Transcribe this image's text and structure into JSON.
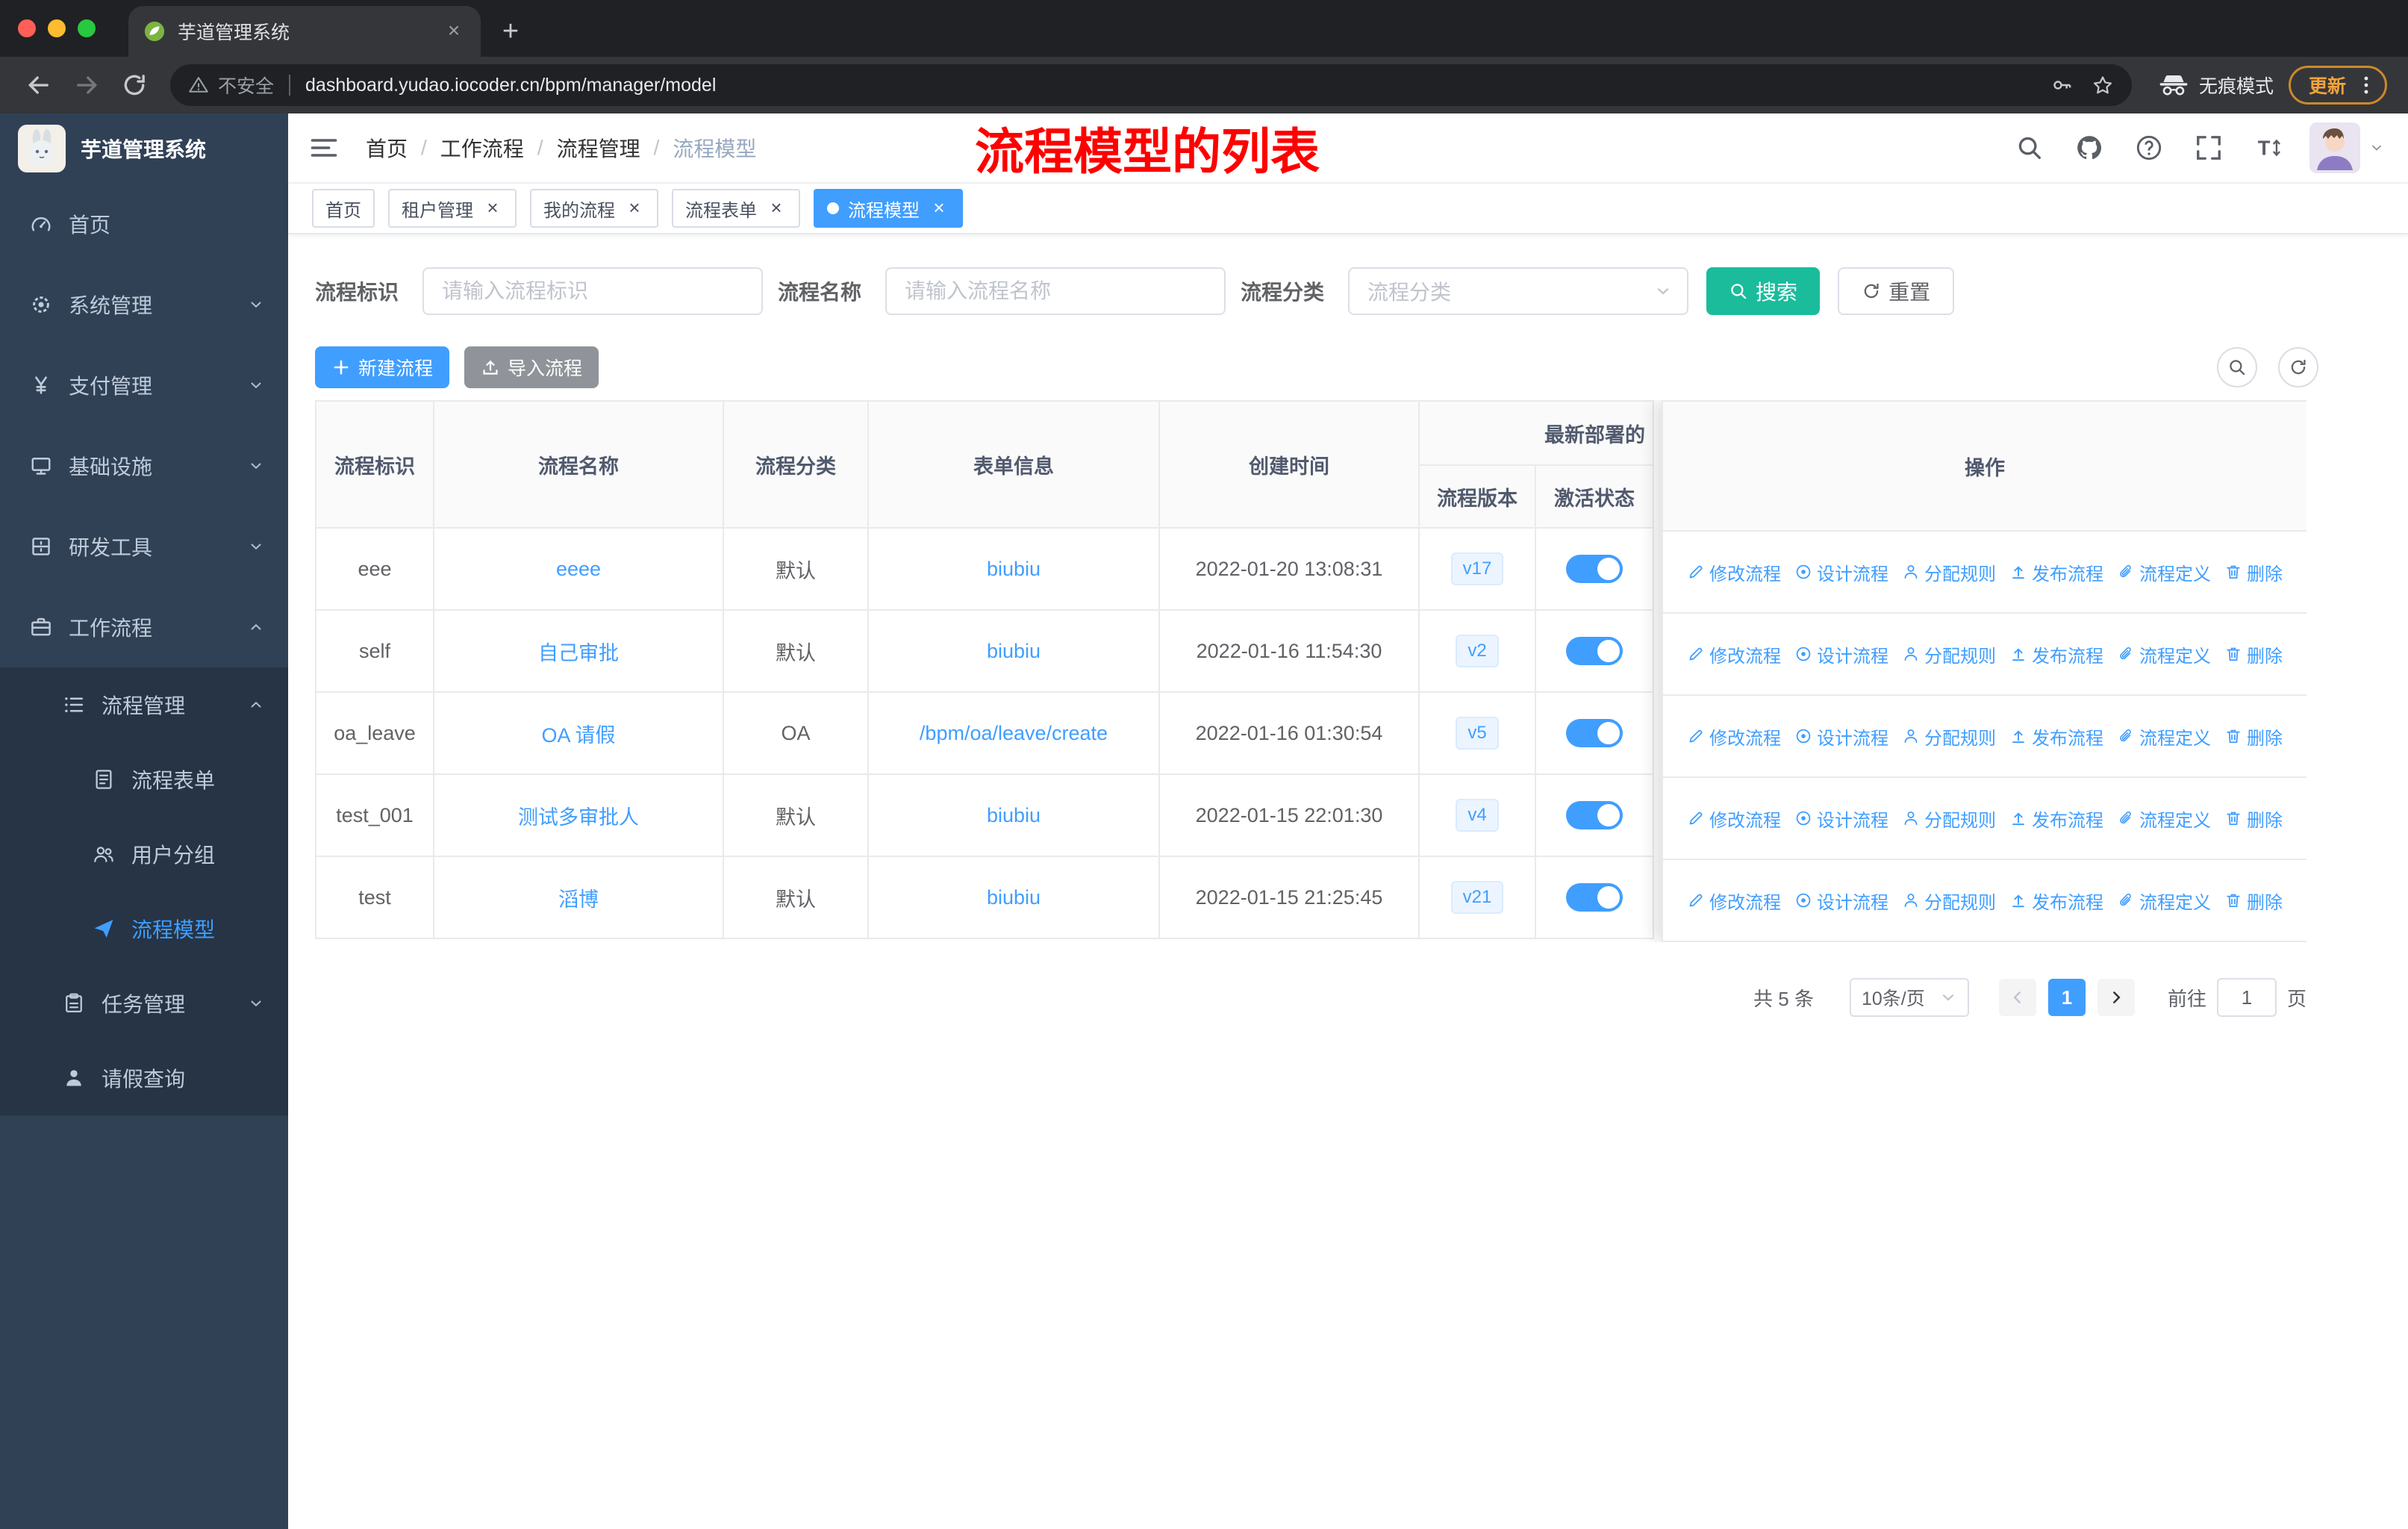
{
  "browser": {
    "tab_title": "芋道管理系统",
    "security_label": "不安全",
    "url": "dashboard.yudao.iocoder.cn/bpm/manager/model",
    "incognito_label": "无痕模式",
    "update_label": "更新"
  },
  "sidebar": {
    "logo_title": "芋道管理系统",
    "items": [
      {
        "key": "home",
        "icon": "dashboard",
        "label": "首页",
        "level": 1,
        "chevron": "",
        "active": false,
        "dark": false
      },
      {
        "key": "system",
        "icon": "gear",
        "label": "系统管理",
        "level": 1,
        "chevron": "down",
        "active": false,
        "dark": false
      },
      {
        "key": "payment",
        "icon": "yen",
        "label": "支付管理",
        "level": 1,
        "chevron": "down",
        "active": false,
        "dark": false
      },
      {
        "key": "infrastructure",
        "icon": "infra",
        "label": "基础设施",
        "level": 1,
        "chevron": "down",
        "active": false,
        "dark": false
      },
      {
        "key": "devtools",
        "icon": "tools",
        "label": "研发工具",
        "level": 1,
        "chevron": "down",
        "active": false,
        "dark": false
      },
      {
        "key": "workflow",
        "icon": "briefcase",
        "label": "工作流程",
        "level": 1,
        "chevron": "up",
        "active": false,
        "dark": false
      },
      {
        "key": "process-management",
        "icon": "list",
        "label": "流程管理",
        "level": 2,
        "chevron": "up",
        "active": false,
        "dark": true
      },
      {
        "key": "process-form",
        "icon": "doc",
        "label": "流程表单",
        "level": 3,
        "chevron": "",
        "active": false,
        "dark": true
      },
      {
        "key": "user-group",
        "icon": "users",
        "label": "用户分组",
        "level": 3,
        "chevron": "",
        "active": false,
        "dark": true
      },
      {
        "key": "process-model",
        "icon": "plane",
        "label": "流程模型",
        "level": 3,
        "chevron": "",
        "active": true,
        "dark": true
      },
      {
        "key": "task-management",
        "icon": "task",
        "label": "任务管理",
        "level": 2,
        "chevron": "down",
        "active": false,
        "dark": true
      },
      {
        "key": "leave-query",
        "icon": "person",
        "label": "请假查询",
        "level": 2,
        "chevron": "",
        "active": false,
        "dark": true
      }
    ]
  },
  "navbar": {
    "breadcrumb": [
      "首页",
      "工作流程",
      "流程管理",
      "流程模型"
    ],
    "annotation": "流程模型的列表",
    "icons": [
      "search",
      "github",
      "question",
      "fullscreen",
      "textsize"
    ]
  },
  "tags": [
    {
      "key": "home",
      "label": "首页",
      "closable": false,
      "active": false
    },
    {
      "key": "tenant-management",
      "label": "租户管理",
      "closable": true,
      "active": false
    },
    {
      "key": "my-process",
      "label": "我的流程",
      "closable": true,
      "active": false
    },
    {
      "key": "process-form",
      "label": "流程表单",
      "closable": true,
      "active": false
    },
    {
      "key": "process-model",
      "label": "流程模型",
      "closable": true,
      "active": true
    }
  ],
  "filters": {
    "id_label": "流程标识",
    "id_placeholder": "请输入流程标识",
    "name_label": "流程名称",
    "name_placeholder": "请输入流程名称",
    "category_label": "流程分类",
    "category_placeholder": "流程分类",
    "search_label": "搜索",
    "reset_label": "重置"
  },
  "actions": {
    "create_label": "新建流程",
    "import_label": "导入流程"
  },
  "table": {
    "headers": {
      "id": "流程标识",
      "name": "流程名称",
      "category": "流程分类",
      "form": "表单信息",
      "created": "创建时间",
      "group": "最新部署的",
      "version": "流程版本",
      "status": "激活状态",
      "ops": "操作"
    },
    "rows": [
      {
        "id": "eee",
        "name": "eeee",
        "category": "默认",
        "form": "biubiu",
        "created": "2022-01-20 13:08:31",
        "version": "v17",
        "active": true
      },
      {
        "id": "self",
        "name": "自己审批",
        "category": "默认",
        "form": "biubiu",
        "created": "2022-01-16 11:54:30",
        "version": "v2",
        "active": true
      },
      {
        "id": "oa_leave",
        "name": "OA 请假",
        "category": "OA",
        "form": "/bpm/oa/leave/create",
        "created": "2022-01-16 01:30:54",
        "version": "v5",
        "active": true
      },
      {
        "id": "test_001",
        "name": "测试多审批人",
        "category": "默认",
        "form": "biubiu",
        "created": "2022-01-15 22:01:30",
        "version": "v4",
        "active": true
      },
      {
        "id": "test",
        "name": "滔博",
        "category": "默认",
        "form": "biubiu",
        "created": "2022-01-15 21:25:45",
        "version": "v21",
        "active": true
      }
    ],
    "ops": [
      {
        "key": "edit",
        "icon": "edit",
        "label": "修改流程"
      },
      {
        "key": "design",
        "icon": "design",
        "label": "设计流程"
      },
      {
        "key": "assign",
        "icon": "assign",
        "label": "分配规则"
      },
      {
        "key": "publish",
        "icon": "publish",
        "label": "发布流程"
      },
      {
        "key": "definition",
        "icon": "definition",
        "label": "流程定义"
      },
      {
        "key": "delete",
        "icon": "delete",
        "label": "删除"
      }
    ]
  },
  "pagination": {
    "total": "共 5 条",
    "page_size": "10条/页",
    "current": "1",
    "goto_label": "前往",
    "goto_value": "1",
    "unit_label": "页"
  },
  "colors": {
    "primary": "#409eff",
    "search_button": "#1abc9c",
    "sidebar": "#304156",
    "sidebar_submenu": "#263445",
    "annotation_red": "#fe0000"
  }
}
